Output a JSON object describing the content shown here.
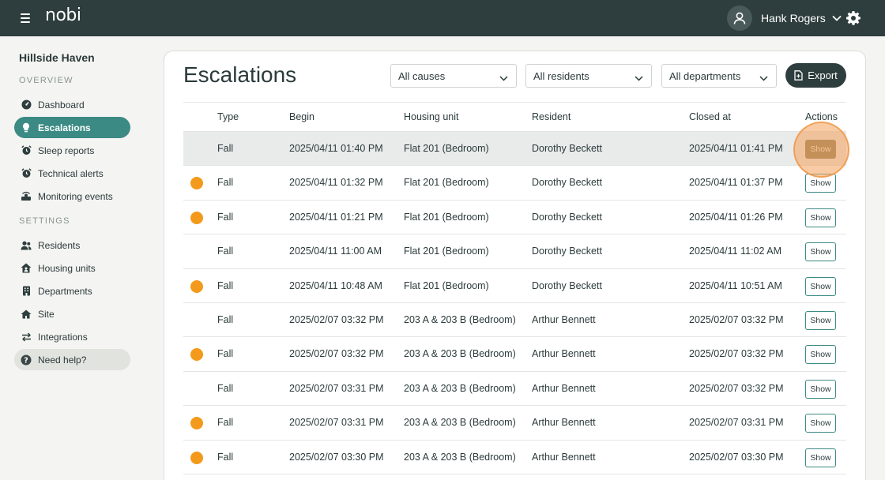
{
  "header": {
    "logo": "nobi",
    "user_name": "Hank Rogers"
  },
  "sidebar": {
    "site_name": "Hillside Haven",
    "overview_label": "OVERVIEW",
    "settings_label": "SETTINGS",
    "items": [
      {
        "label": "Dashboard",
        "icon": "dashboard-icon"
      },
      {
        "label": "Escalations",
        "icon": "bulb-icon",
        "active": true
      },
      {
        "label": "Sleep reports",
        "icon": "alarm-clock-icon"
      },
      {
        "label": "Technical alerts",
        "icon": "alarm-clock-icon"
      },
      {
        "label": "Monitoring events",
        "icon": "broadcast-icon"
      },
      {
        "label": "Residents",
        "icon": "users-icon"
      },
      {
        "label": "Housing units",
        "icon": "house-user-icon"
      },
      {
        "label": "Departments",
        "icon": "building-icon"
      },
      {
        "label": "Site",
        "icon": "home-icon"
      },
      {
        "label": "Integrations",
        "icon": "exchange-arrows-icon"
      },
      {
        "label": "Need help?",
        "icon": "question-icon"
      }
    ]
  },
  "main": {
    "title": "Escalations",
    "filters": {
      "causes": "All causes",
      "residents": "All residents",
      "departments": "All departments"
    },
    "export_label": "Export",
    "columns": [
      "Type",
      "Begin",
      "Housing unit",
      "Resident",
      "Closed at",
      "Actions"
    ],
    "show_label": "Show",
    "rows": [
      {
        "dot": false,
        "type": "Fall",
        "begin": "2025/04/11 01:40 PM",
        "unit": "Flat 201 (Bedroom)",
        "resident": "Dorothy Beckett",
        "closed": "2025/04/11 01:41 PM"
      },
      {
        "dot": true,
        "type": "Fall",
        "begin": "2025/04/11 01:32 PM",
        "unit": "Flat 201 (Bedroom)",
        "resident": "Dorothy Beckett",
        "closed": "2025/04/11 01:37 PM"
      },
      {
        "dot": true,
        "type": "Fall",
        "begin": "2025/04/11 01:21 PM",
        "unit": "Flat 201 (Bedroom)",
        "resident": "Dorothy Beckett",
        "closed": "2025/04/11 01:26 PM"
      },
      {
        "dot": false,
        "type": "Fall",
        "begin": "2025/04/11 11:00 AM",
        "unit": "Flat 201 (Bedroom)",
        "resident": "Dorothy Beckett",
        "closed": "2025/04/11 11:02 AM"
      },
      {
        "dot": true,
        "type": "Fall",
        "begin": "2025/04/11 10:48 AM",
        "unit": "Flat 201 (Bedroom)",
        "resident": "Dorothy Beckett",
        "closed": "2025/04/11 10:51 AM"
      },
      {
        "dot": false,
        "type": "Fall",
        "begin": "2025/02/07 03:32 PM",
        "unit": "203 A & 203 B (Bedroom)",
        "resident": "Arthur Bennett",
        "closed": "2025/02/07 03:32 PM"
      },
      {
        "dot": true,
        "type": "Fall",
        "begin": "2025/02/07 03:32 PM",
        "unit": "203 A & 203 B (Bedroom)",
        "resident": "Arthur Bennett",
        "closed": "2025/02/07 03:32 PM"
      },
      {
        "dot": false,
        "type": "Fall",
        "begin": "2025/02/07 03:31 PM",
        "unit": "203 A & 203 B (Bedroom)",
        "resident": "Arthur Bennett",
        "closed": "2025/02/07 03:32 PM"
      },
      {
        "dot": true,
        "type": "Fall",
        "begin": "2025/02/07 03:31 PM",
        "unit": "203 A & 203 B (Bedroom)",
        "resident": "Arthur Bennett",
        "closed": "2025/02/07 03:31 PM"
      },
      {
        "dot": true,
        "type": "Fall",
        "begin": "2025/02/07 03:30 PM",
        "unit": "203 A & 203 B (Bedroom)",
        "resident": "Arthur Bennett",
        "closed": "2025/02/07 03:30 PM"
      }
    ]
  },
  "colors": {
    "topbar": "#2e3d3d",
    "accent": "#3b8a83",
    "status_dot": "#f39a1c"
  }
}
